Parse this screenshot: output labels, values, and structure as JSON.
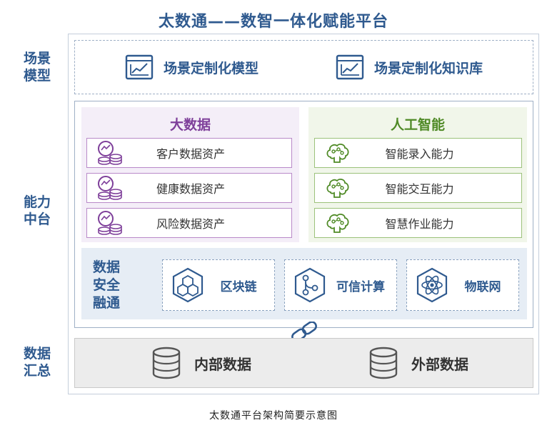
{
  "title": "太数通——数智一体化赋能平台",
  "rows": {
    "scene": [
      "场景",
      "模型"
    ],
    "capability": [
      "能力",
      "中台"
    ],
    "data": [
      "数据",
      "汇总"
    ]
  },
  "scene_items": [
    {
      "label": "场景定制化模型",
      "icon": "chart-window-icon"
    },
    {
      "label": "场景定制化知识库",
      "icon": "chart-window-icon"
    }
  ],
  "big_data": {
    "title": "大数据",
    "items": [
      {
        "label": "客户数据资产",
        "icon": "coin-stack-icon"
      },
      {
        "label": "健康数据资产",
        "icon": "coin-stack-icon"
      },
      {
        "label": "风险数据资产",
        "icon": "coin-stack-icon"
      }
    ]
  },
  "ai": {
    "title": "人工智能",
    "items": [
      {
        "label": "智能录入能力",
        "icon": "brain-icon"
      },
      {
        "label": "智能交互能力",
        "icon": "brain-icon"
      },
      {
        "label": "智慧作业能力",
        "icon": "brain-icon"
      }
    ]
  },
  "security": {
    "label": [
      "数据",
      "安全",
      "融通"
    ],
    "items": [
      {
        "label": "区块链",
        "icon": "blockchain-cubes-icon"
      },
      {
        "label": "可信计算",
        "icon": "trusted-compute-icon"
      },
      {
        "label": "物联网",
        "icon": "atom-icon"
      }
    ]
  },
  "data_sources": [
    {
      "label": "内部数据",
      "icon": "database-icon"
    },
    {
      "label": "外部数据",
      "icon": "database-icon"
    }
  ],
  "caption": "太数通平台架构简要示意图",
  "colors": {
    "primary_blue": "#2f5a8f",
    "purple": "#7e3f9a",
    "green": "#4f8a26",
    "purple_bg": "#f4eef8",
    "green_bg": "#f1f6ea",
    "blue_bg": "#e6edf5",
    "gray_bg": "#ececec"
  }
}
